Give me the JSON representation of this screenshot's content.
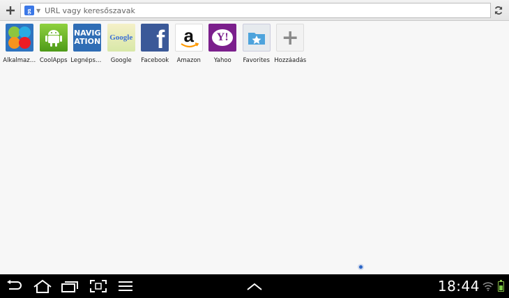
{
  "toolbar": {
    "add_tab_icon": "plus-icon",
    "reload_icon": "reload-icon",
    "search_engine_icon": "google-icon",
    "url_placeholder": "URL vagy keresőszavak"
  },
  "speed_dial": [
    {
      "label": "Alkalmazá...",
      "icon": "apps-flower-icon"
    },
    {
      "label": "CoolApps",
      "icon": "android-icon"
    },
    {
      "label": "Legnépsz...",
      "icon": "navigation-icon",
      "icon_text": "NAVIG ATION"
    },
    {
      "label": "Google",
      "icon": "google-icon",
      "icon_text": "Google"
    },
    {
      "label": "Facebook",
      "icon": "facebook-icon",
      "icon_text": "f"
    },
    {
      "label": "Amazon",
      "icon": "amazon-icon",
      "icon_text": "a"
    },
    {
      "label": "Yahoo",
      "icon": "yahoo-icon",
      "icon_text": "Y!"
    },
    {
      "label": "Favorites",
      "icon": "favorites-star-icon"
    },
    {
      "label": "Hozzáadás",
      "icon": "add-icon",
      "icon_text": "+"
    }
  ],
  "pager": {
    "pages": 1,
    "current": 1
  },
  "system_bar": {
    "clock": "18:44",
    "buttons": [
      "back-icon",
      "home-icon",
      "recent-apps-icon",
      "screenshot-icon",
      "menu-icon",
      "chevron-up-icon"
    ],
    "battery_level": 0.6,
    "accent": "#2b65c6"
  }
}
